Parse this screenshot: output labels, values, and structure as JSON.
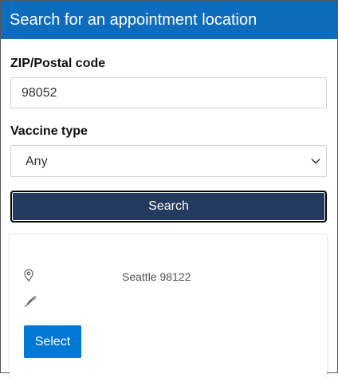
{
  "header": {
    "title": "Search for an appointment location"
  },
  "form": {
    "zip_label": "ZIP/Postal code",
    "zip_value": "98052",
    "vaccine_label": "Vaccine type",
    "vaccine_value": "Any",
    "search_label": "Search"
  },
  "results": [
    {
      "city": "Seattle 98122",
      "location_icon": "map-pin-icon",
      "vaccine_icon": "syringe-icon",
      "select_label": "Select"
    }
  ],
  "colors": {
    "header_bg": "#0f6cbd",
    "search_bg": "#243a5e",
    "select_bg": "#0078d4"
  }
}
